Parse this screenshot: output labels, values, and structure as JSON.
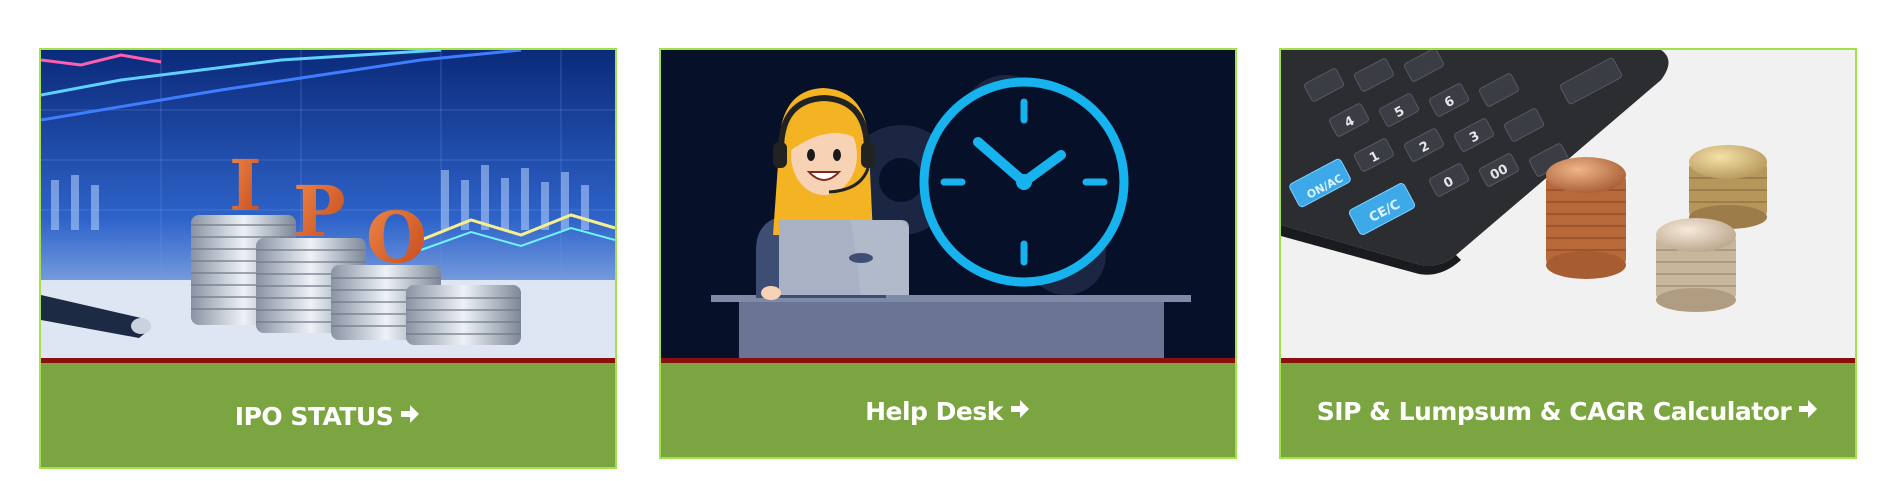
{
  "cards": [
    {
      "title": "IPO STATUS",
      "image_icon": "ipo-coins-image",
      "image_letters": [
        "I",
        "P",
        "O"
      ]
    },
    {
      "title": "Help Desk",
      "image_icon": "help-desk-support-image"
    },
    {
      "title": "SIP & Lumpsum & CAGR Calculator",
      "image_icon": "calculator-coins-image",
      "calculator_keys": [
        "ON/AC",
        "CE/C",
        "0",
        "00",
        "1",
        "2",
        "3",
        "4",
        "5",
        "6"
      ]
    }
  ],
  "colors": {
    "caption_bg": "#7ba540",
    "card_border": "#a3e14a",
    "image_divider": "#8b0f0f",
    "caption_text": "#ffffff",
    "accent_orange": "#e8642a",
    "accent_cyan": "#16b3ef",
    "navy": "#0a1530"
  },
  "icons": {
    "caption_arrow": "arrow-right-icon"
  }
}
